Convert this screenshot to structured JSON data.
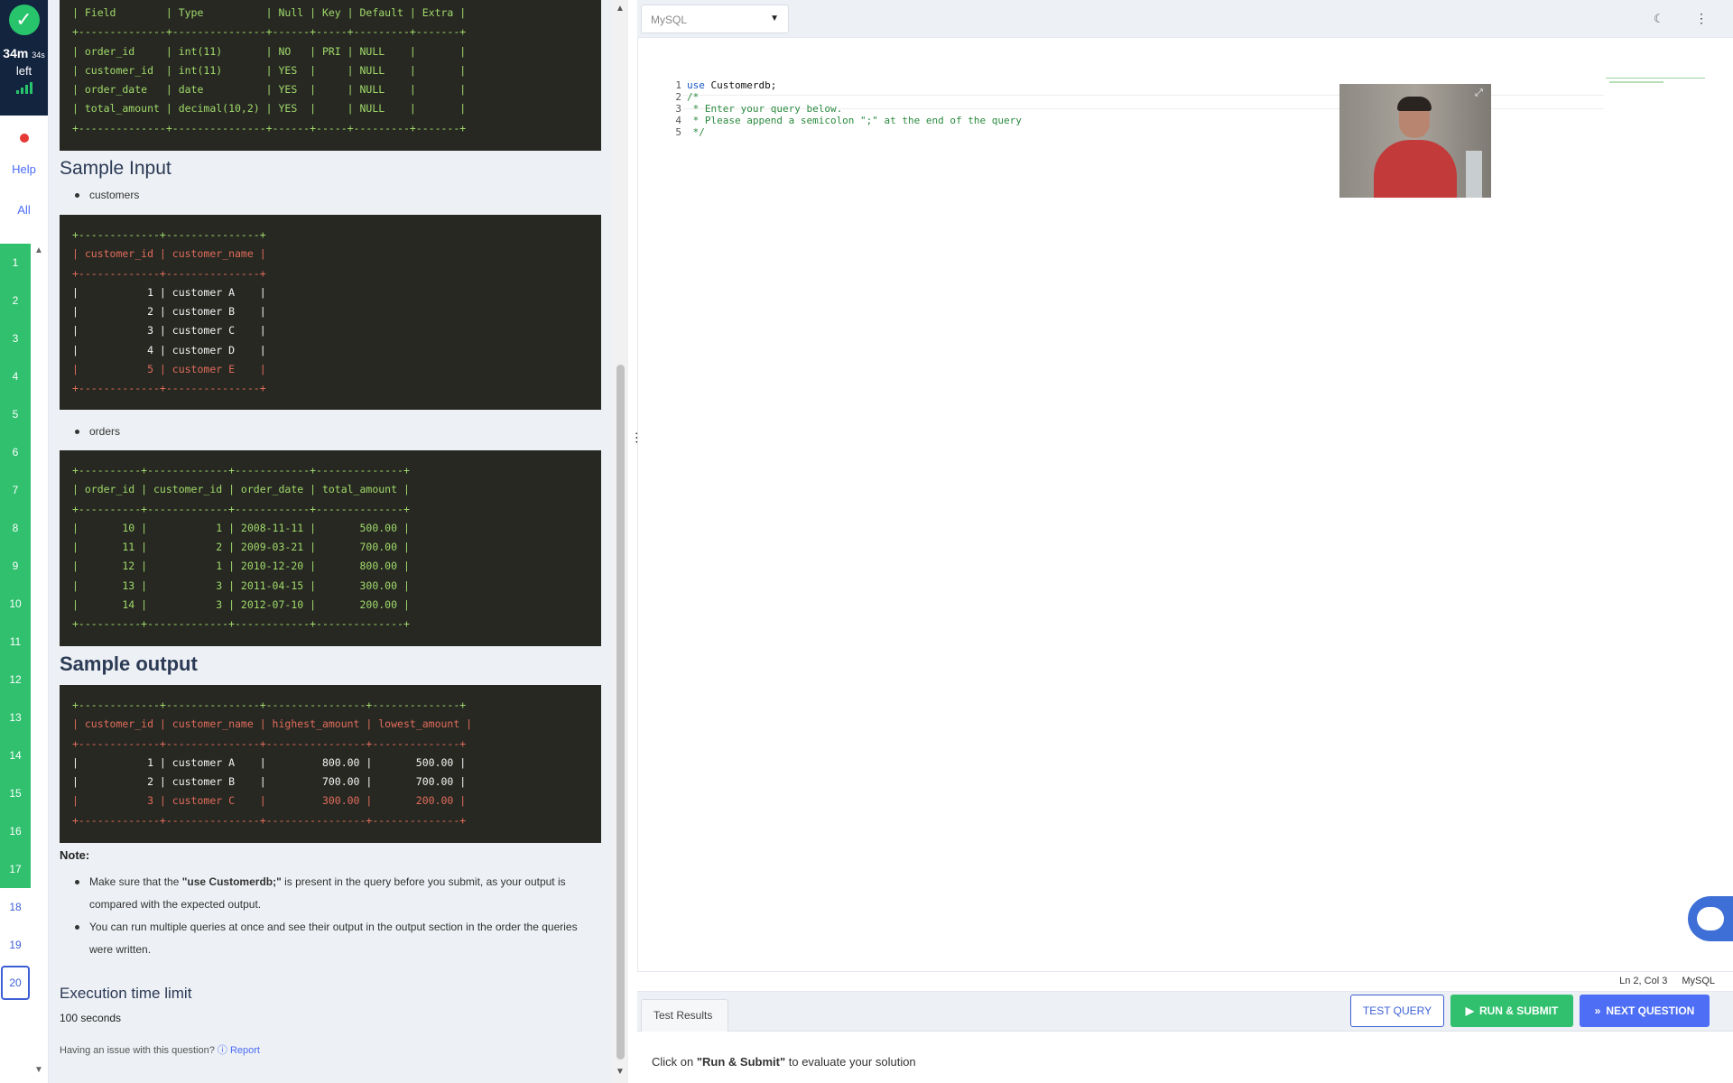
{
  "rail": {
    "timer_main": "34m",
    "timer_sec": "34s",
    "timer_left": "left",
    "help": "Help",
    "all": "All",
    "questions": [
      "1",
      "2",
      "3",
      "4",
      "5",
      "6",
      "7",
      "8",
      "9",
      "10",
      "11",
      "12",
      "13",
      "14",
      "15",
      "16",
      "17",
      "18",
      "19",
      "20"
    ],
    "done_count": 17,
    "current": "20"
  },
  "left": {
    "schema_lines": [
      "| Field        | Type          | Null | Key | Default | Extra |",
      "+--------------+---------------+------+-----+---------+-------+",
      "| order_id     | int(11)       | NO   | PRI | NULL    |       |",
      "| customer_id  | int(11)       | YES  |     | NULL    |       |",
      "| order_date   | date          | YES  |     | NULL    |       |",
      "| total_amount | decimal(10,2) | YES  |     | NULL    |       |",
      "+--------------+---------------+------+-----+---------+-------+"
    ],
    "sample_input_title": "Sample Input",
    "customers_label": "customers",
    "customers_table": [
      "+-------------+---------------+",
      "| customer_id | customer_name |",
      "+-------------+---------------+",
      "|           1 | customer A    |",
      "|           2 | customer B    |",
      "|           3 | customer C    |",
      "|           4 | customer D    |",
      "|           5 | customer E    |",
      "+-------------+---------------+"
    ],
    "orders_label": "orders",
    "orders_table": [
      "+----------+-------------+------------+--------------+",
      "| order_id | customer_id | order_date | total_amount |",
      "+----------+-------------+------------+--------------+",
      "|       10 |           1 | 2008-11-11 |       500.00 |",
      "|       11 |           2 | 2009-03-21 |       700.00 |",
      "|       12 |           1 | 2010-12-20 |       800.00 |",
      "|       13 |           3 | 2011-04-15 |       300.00 |",
      "|       14 |           3 | 2012-07-10 |       200.00 |",
      "+----------+-------------+------------+--------------+"
    ],
    "sample_output_title": "Sample output",
    "output_table": [
      "+-------------+---------------+----------------+--------------+",
      "| customer_id | customer_name | highest_amount | lowest_amount |",
      "+-------------+---------------+----------------+--------------+",
      "|           1 | customer A    |         800.00 |       500.00 |",
      "|           2 | customer B    |         700.00 |       700.00 |",
      "|           3 | customer C    |         300.00 |       200.00 |",
      "+-------------+---------------+----------------+--------------+"
    ],
    "note_title": "Note:",
    "note_1_pre": "Make sure that the ",
    "note_1_bold": "\"use Customerdb;\"",
    "note_1_post": " is present in the query before you submit, as your output is compared with the expected output.",
    "note_2": "You can run multiple queries at once and see their output in the output section in the order the queries were written.",
    "exec_title": "Execution time limit",
    "exec_value": "100 seconds",
    "issue_text": "Having an issue with this question?",
    "report": "Report"
  },
  "editor": {
    "language": "MySQL",
    "lines": [
      {
        "n": "1",
        "kw": "use",
        "rest": " Customerdb;"
      },
      {
        "n": "2",
        "text": "/*"
      },
      {
        "n": "3",
        "text": " * Enter your query below."
      },
      {
        "n": "4",
        "text": " * Please append a semicolon \";\" at the end of the query"
      },
      {
        "n": "5",
        "text": " */"
      }
    ],
    "cursor_pos": "Ln 2, Col 3",
    "status_lang": "MySQL"
  },
  "bottom": {
    "tab": "Test Results",
    "test_btn": "TEST QUERY",
    "run_btn": "RUN & SUBMIT",
    "next_btn": "NEXT QUESTION",
    "msg_pre": "Click on ",
    "msg_bold": "\"Run & Submit\"",
    "msg_post": " to evaluate your solution"
  },
  "colors": {
    "accent_green": "#30c06e",
    "accent_blue": "#4d6ef5",
    "navy": "#13243f"
  }
}
